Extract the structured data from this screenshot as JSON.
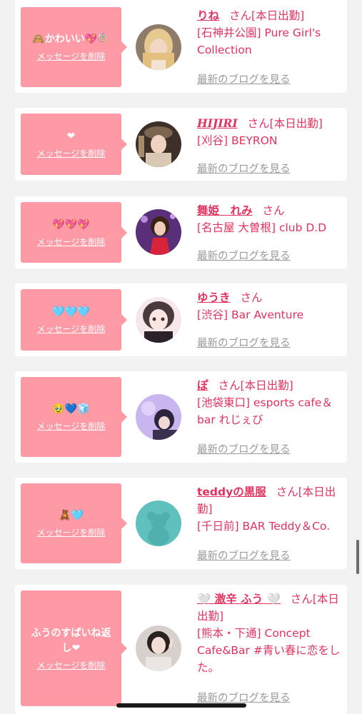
{
  "delete_label": "メッセージを削除",
  "blog_label": "最新のブログを見る",
  "san_label": "さん",
  "entries": [
    {
      "message": "🙈かわいい💖🍭",
      "name": "りね",
      "status": "[本日出勤]",
      "shop": "[石神井公園] Pure Girl's Collection",
      "avatar_icon": "avatar-photo-blonde"
    },
    {
      "message": "❤",
      "name": "HIJIRI",
      "status": "[本日出勤]",
      "shop": "[刈谷] BEYRON",
      "avatar_icon": "avatar-photo-cap"
    },
    {
      "message": "💖💖💖",
      "name": "舞姫　れみ",
      "status": "",
      "shop": "[名古屋 大曽根] club D.D",
      "avatar_icon": "avatar-photo-red-dress"
    },
    {
      "message": "🩵🩵🩵",
      "name": "ゆうき",
      "status": "",
      "shop": "[渋谷] Bar Aventure",
      "avatar_icon": "avatar-photo-pink-hair"
    },
    {
      "message": "🥹💙🧊",
      "name": "ぽ",
      "status": "[本日出勤]",
      "shop": "[池袋東口] esports cafe＆bar れじぇび",
      "avatar_icon": "avatar-photo-purple-light"
    },
    {
      "message": "🧸🩵",
      "name": "teddyの黒服",
      "status": "[本日出勤]",
      "shop": "[千日前] BAR Teddy＆Co.",
      "avatar_icon": "avatar-teddy-placeholder"
    },
    {
      "message": "ふうのすぱいね返し❤",
      "name": "🤍 激辛 ふう 🤍",
      "status": "[本日出勤]",
      "shop": "[熊本・下通] Concept Cafe&Bar #青い春に恋をした。",
      "avatar_icon": "avatar-photo-peace-sign"
    }
  ],
  "colors": {
    "bubble": "#fd9aa6",
    "name": "#e2335e",
    "blog_link": "#9a9a9a",
    "background": "#f2f2f2"
  }
}
